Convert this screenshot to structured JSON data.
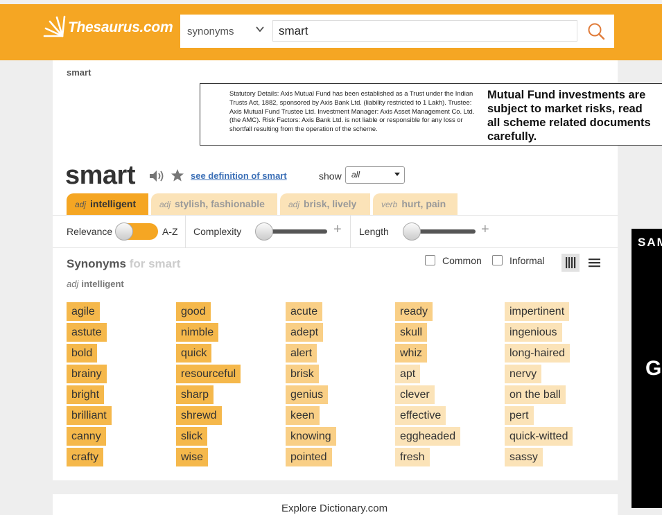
{
  "header": {
    "logo_text": "Thesaurus.com",
    "search_mode": "synonyms",
    "search_value": "smart"
  },
  "breadcrumb": "smart",
  "ad_banner": {
    "small_text": "Statutory Details: Axis Mutual Fund has been established as a Trust under the Indian Trusts Act, 1882, sponsored by Axis Bank Ltd. (liability restricted to 1 Lakh). Trustee: Axis Mutual Fund Trustee Ltd. Investment Manager: Axis Asset Management Co. Ltd. (the AMC). Risk Factors: Axis Bank Ltd. is not liable or responsible for any loss or shortfall resulting from the operation of the scheme.",
    "big_line_1": "Mutual Fund investments are",
    "big_line_2": "subject to market risks, read",
    "big_line_3": "all scheme related documents",
    "big_line_4": "carefully."
  },
  "word": {
    "title": "smart",
    "definition_link": "see definition of smart",
    "show_label": "show",
    "show_value": "all"
  },
  "tabs": [
    {
      "pos": "adj",
      "label": "intelligent",
      "active": true
    },
    {
      "pos": "adj",
      "label": "stylish, fashionable",
      "active": false
    },
    {
      "pos": "adj",
      "label": "brisk, lively",
      "active": false
    },
    {
      "pos": "verb",
      "label": "hurt, pain",
      "active": false
    }
  ],
  "filters": {
    "relevance_label": "Relevance",
    "az_label": "A-Z",
    "complexity_label": "Complexity",
    "length_label": "Length"
  },
  "synonyms_header": {
    "title": "Synonyms",
    "for_text": "for smart",
    "common_label": "Common",
    "informal_label": "Informal"
  },
  "sense": {
    "pos": "adj",
    "label": "intelligent"
  },
  "synonym_columns": [
    [
      {
        "word": "agile",
        "rel": 3
      },
      {
        "word": "astute",
        "rel": 3
      },
      {
        "word": "bold",
        "rel": 3
      },
      {
        "word": "brainy",
        "rel": 3
      },
      {
        "word": "bright",
        "rel": 3
      },
      {
        "word": "brilliant",
        "rel": 3
      },
      {
        "word": "canny",
        "rel": 3
      },
      {
        "word": "crafty",
        "rel": 3
      }
    ],
    [
      {
        "word": "good",
        "rel": 3
      },
      {
        "word": "nimble",
        "rel": 3
      },
      {
        "word": "quick",
        "rel": 3
      },
      {
        "word": "resourceful",
        "rel": 3
      },
      {
        "word": "sharp",
        "rel": 3
      },
      {
        "word": "shrewd",
        "rel": 3
      },
      {
        "word": "slick",
        "rel": 3
      },
      {
        "word": "wise",
        "rel": 3
      }
    ],
    [
      {
        "word": "acute",
        "rel": 2
      },
      {
        "word": "adept",
        "rel": 2
      },
      {
        "word": "alert",
        "rel": 2
      },
      {
        "word": "brisk",
        "rel": 2
      },
      {
        "word": "genius",
        "rel": 2
      },
      {
        "word": "keen",
        "rel": 2
      },
      {
        "word": "knowing",
        "rel": 2
      },
      {
        "word": "pointed",
        "rel": 2
      }
    ],
    [
      {
        "word": "ready",
        "rel": 2
      },
      {
        "word": "skull",
        "rel": 2
      },
      {
        "word": "whiz",
        "rel": 2
      },
      {
        "word": "apt",
        "rel": 1
      },
      {
        "word": "clever",
        "rel": 1
      },
      {
        "word": "effective",
        "rel": 1
      },
      {
        "word": "eggheaded",
        "rel": 1
      },
      {
        "word": "fresh",
        "rel": 1
      }
    ],
    [
      {
        "word": "impertinent",
        "rel": 1
      },
      {
        "word": "ingenious",
        "rel": 1
      },
      {
        "word": "long-haired",
        "rel": 1
      },
      {
        "word": "nervy",
        "rel": 1
      },
      {
        "word": "on the ball",
        "rel": 1
      },
      {
        "word": "pert",
        "rel": 1
      },
      {
        "word": "quick-witted",
        "rel": 1
      },
      {
        "word": "sassy",
        "rel": 1
      }
    ]
  ],
  "bottom": {
    "text": "Explore Dictionary.com"
  },
  "side_ad": {
    "text1": "SAMSUNG",
    "text2": "G"
  },
  "colors": {
    "brand_orange": "#f5a623",
    "relevance_high": "#f5b84b",
    "relevance_mid": "#f9cf86",
    "relevance_low": "#fbe3b8",
    "link_blue": "#3b6fb6"
  }
}
